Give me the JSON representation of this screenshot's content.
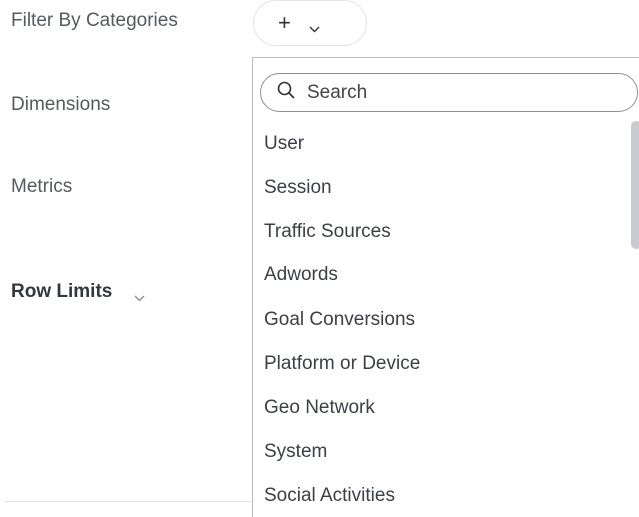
{
  "panel": {
    "filter_label": "Filter By Categories",
    "dimensions_label": "Dimensions",
    "metrics_label": "Metrics",
    "row_limits_label": "Row Limits"
  },
  "add_button": {
    "symbol": "+",
    "icon": "chevron-down-icon"
  },
  "dropdown": {
    "search_placeholder": "Search",
    "items": [
      "User",
      "Session",
      "Traffic Sources",
      "Adwords",
      "Goal Conversions",
      "Platform or Device",
      "Geo Network",
      "System",
      "Social Activities"
    ]
  }
}
